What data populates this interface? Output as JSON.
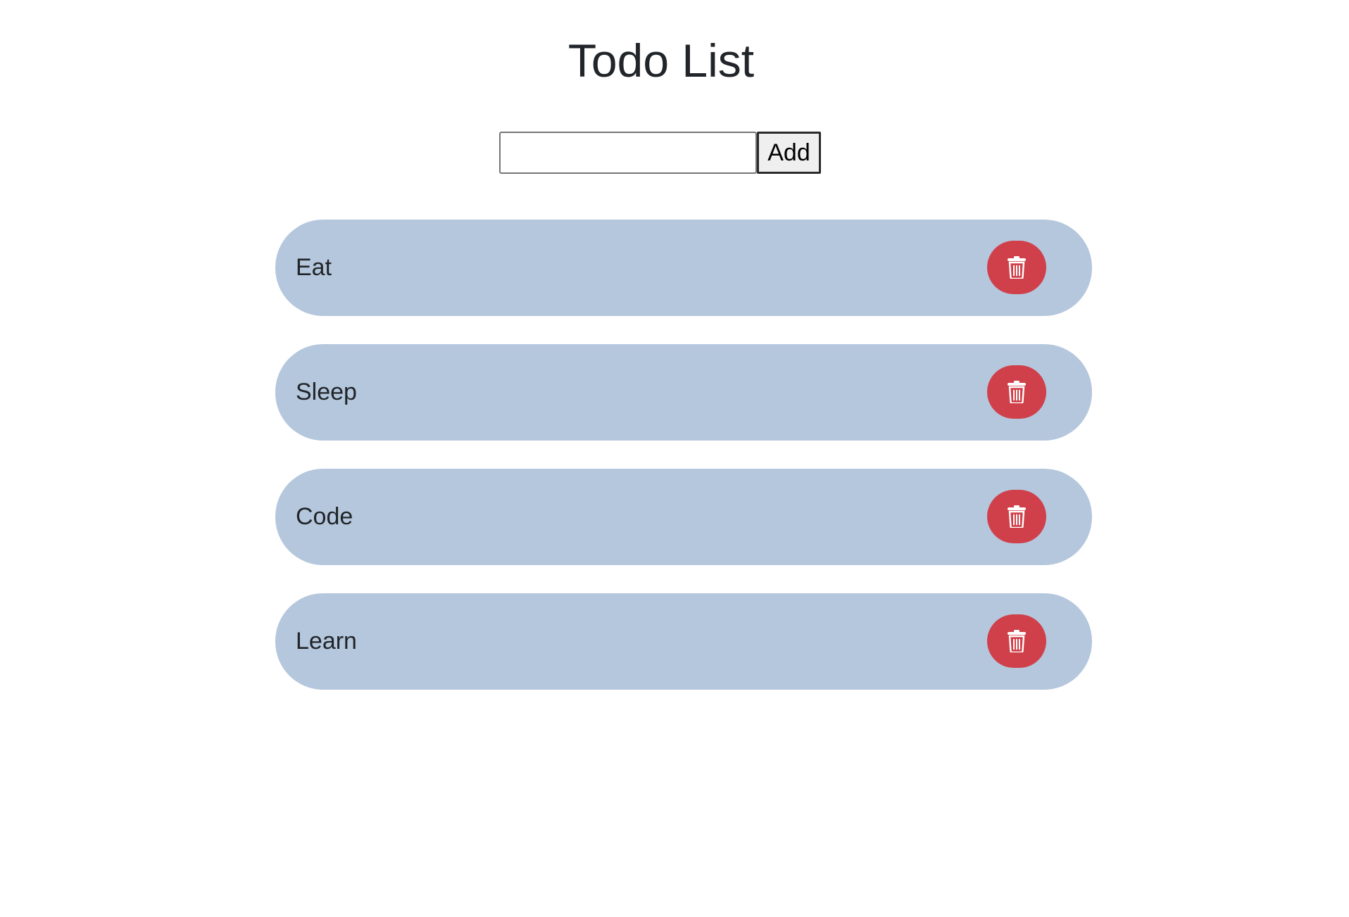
{
  "header": {
    "title": "Todo List"
  },
  "form": {
    "input_value": "",
    "input_placeholder": "",
    "add_label": "Add"
  },
  "todos": [
    {
      "text": "Eat",
      "delete_icon": "trash-icon"
    },
    {
      "text": "Sleep",
      "delete_icon": "trash-icon"
    },
    {
      "text": "Code",
      "delete_icon": "trash-icon"
    },
    {
      "text": "Learn",
      "delete_icon": "trash-icon"
    }
  ],
  "colors": {
    "item_background": "#b5c7dd",
    "delete_button": "#d0404a",
    "text": "#212529"
  }
}
